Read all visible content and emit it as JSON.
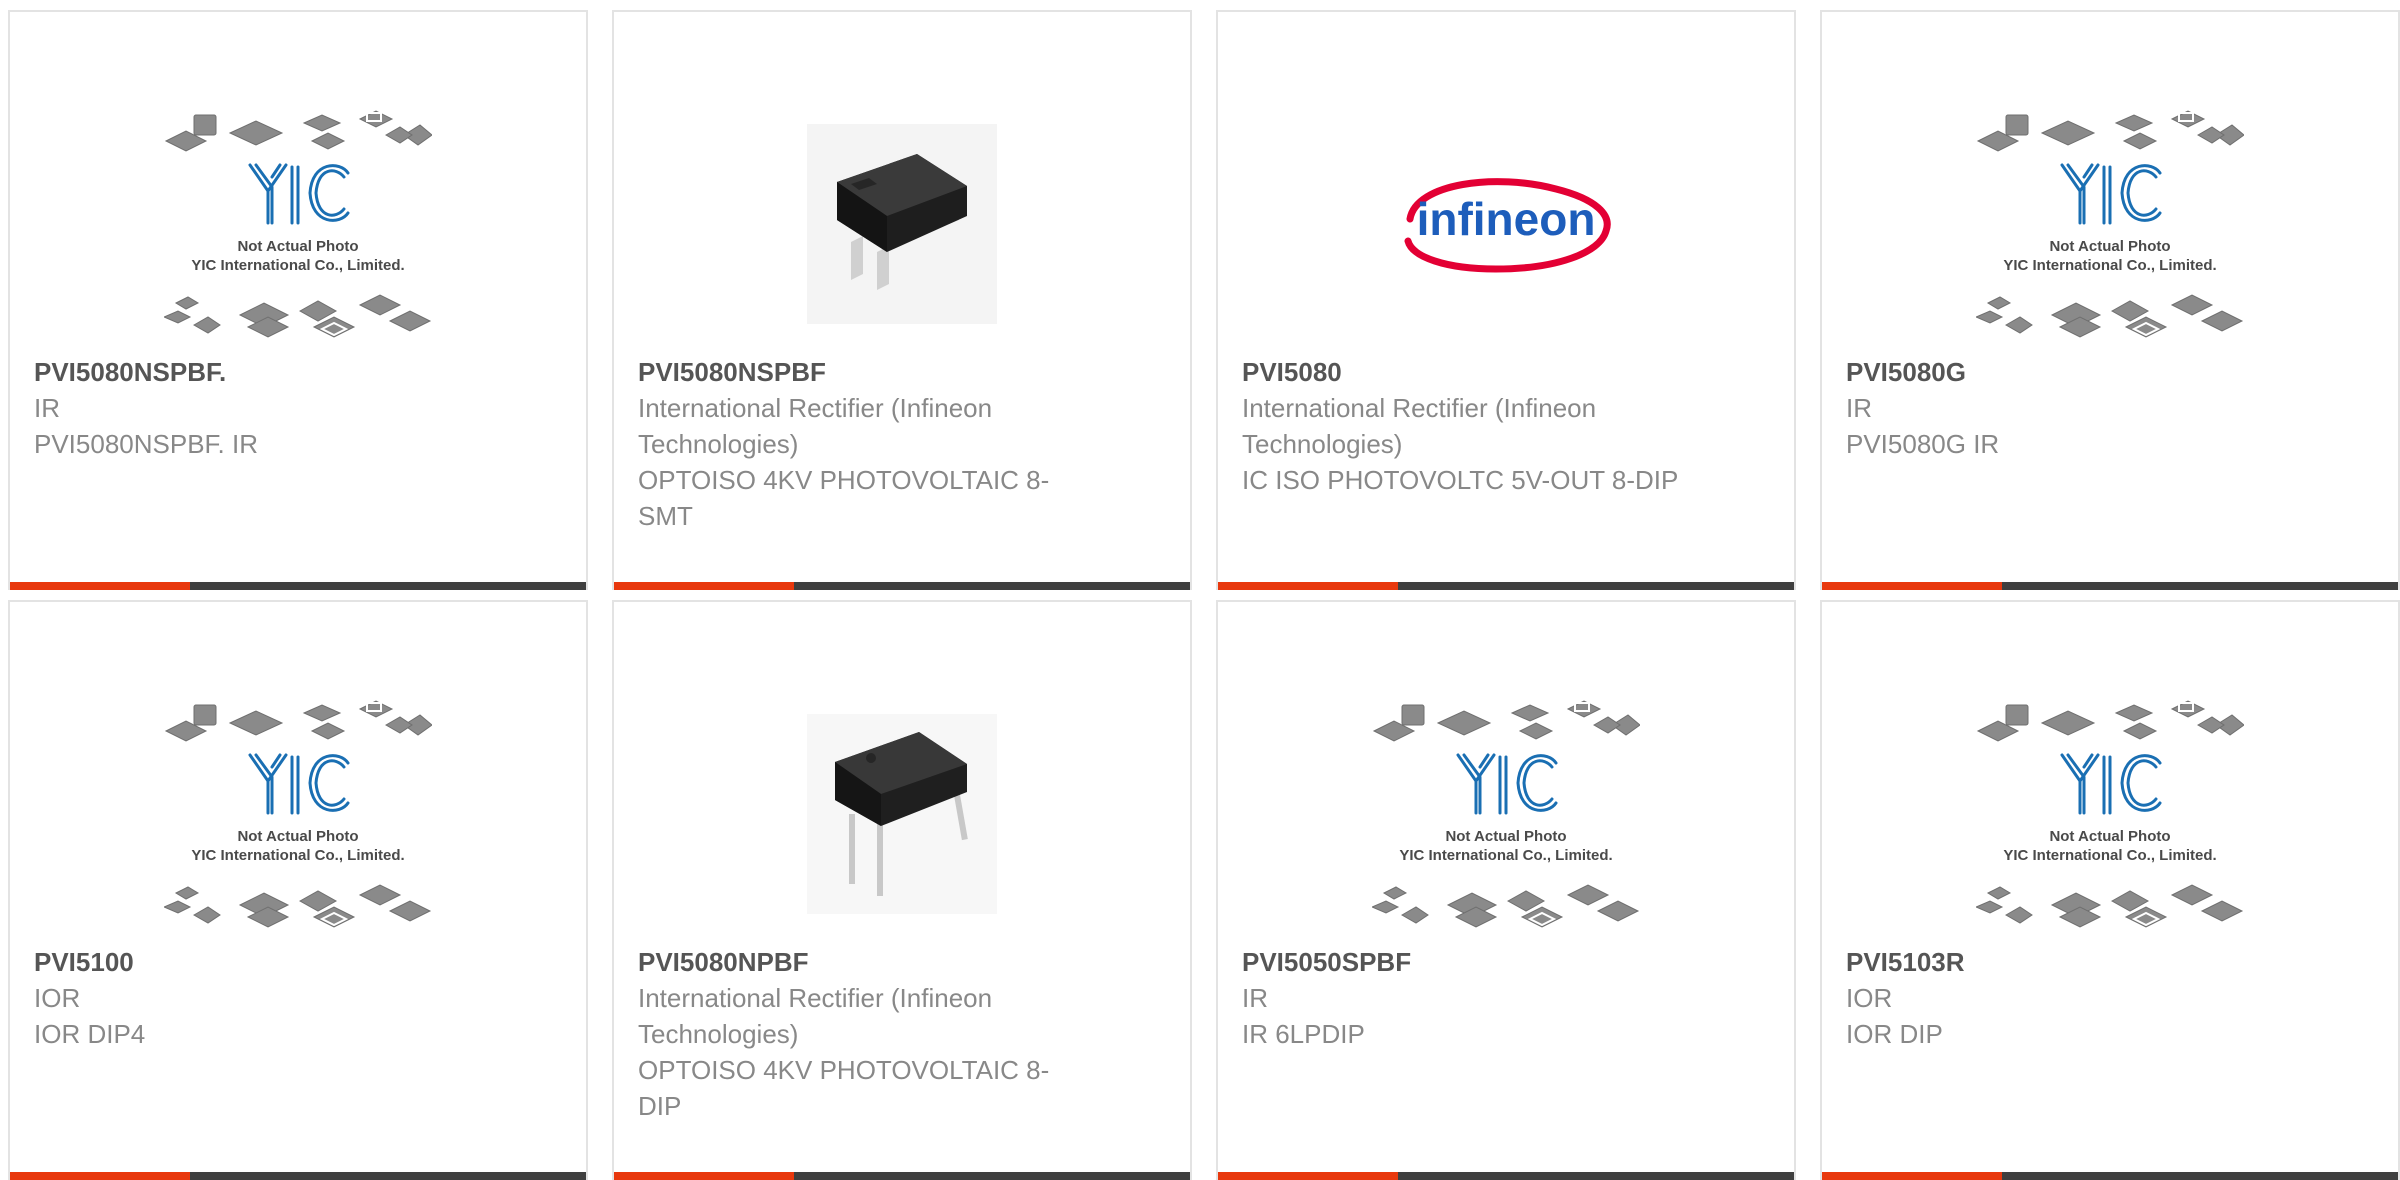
{
  "placeholder": {
    "line1": "Not Actual Photo",
    "line2": "YIC International Co., Limited.",
    "logo": "YIC"
  },
  "infineon_logo_text": "infineon",
  "colors": {
    "accent": "#e8380d",
    "bar": "#3f3f3f",
    "yic_blue": "#1a6fb3",
    "infineon_red": "#e30034",
    "infineon_blue": "#1d5dbb"
  },
  "products": [
    {
      "part": "PVI5080NSPBF.",
      "manufacturer": "IR",
      "description": "PVI5080NSPBF. IR",
      "image": "not-actual-photo"
    },
    {
      "part": "PVI5080NSPBF",
      "manufacturer": "International Rectifier (Infineon Technologies)",
      "description": "OPTOISO 4KV PHOTOVOLTAIC 8-SMT",
      "image": "smt-chip-photo"
    },
    {
      "part": "PVI5080",
      "manufacturer": "International Rectifier (Infineon Technologies)",
      "description": "IC ISO PHOTOVOLTC 5V-OUT 8-DIP",
      "image": "infineon-logo"
    },
    {
      "part": "PVI5080G",
      "manufacturer": "IR",
      "description": "PVI5080G IR",
      "image": "not-actual-photo"
    },
    {
      "part": "PVI5100",
      "manufacturer": "IOR",
      "description": "IOR DIP4",
      "image": "not-actual-photo"
    },
    {
      "part": "PVI5080NPBF",
      "manufacturer": "International Rectifier (Infineon Technologies)",
      "description": "OPTOISO 4KV PHOTOVOLTAIC 8-DIP",
      "image": "dip-chip-photo"
    },
    {
      "part": "PVI5050SPBF",
      "manufacturer": "IR",
      "description": "IR 6LPDIP",
      "image": "not-actual-photo"
    },
    {
      "part": "PVI5103R",
      "manufacturer": "IOR",
      "description": "IOR DIP",
      "image": "not-actual-photo"
    }
  ]
}
